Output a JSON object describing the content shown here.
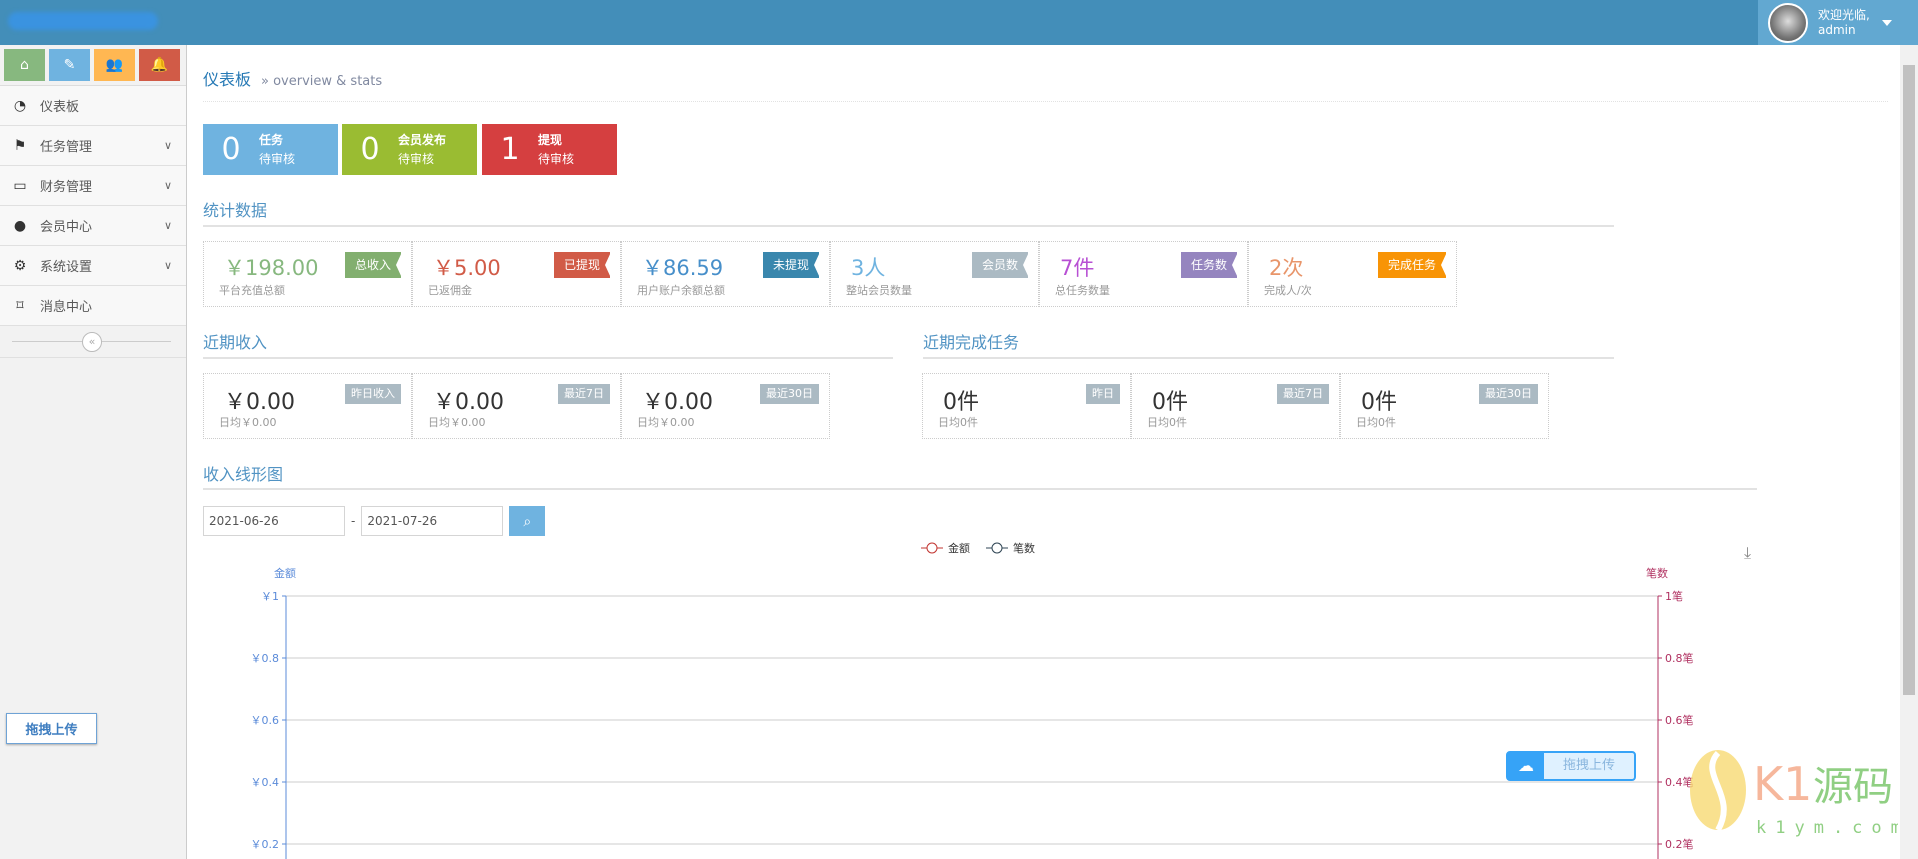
{
  "header": {
    "welcome": "欢迎光临,",
    "user": "admin"
  },
  "sidebar": {
    "shortcuts": [
      {
        "icon": "home-icon",
        "color": "#87b87f"
      },
      {
        "icon": "pencil-icon",
        "color": "#6fb3e0"
      },
      {
        "icon": "users-icon",
        "color": "#ffb752"
      },
      {
        "icon": "bell-icon",
        "color": "#d15b47"
      }
    ],
    "items": [
      {
        "label": "仪表板",
        "icon": "dashboard-icon"
      },
      {
        "label": "任务管理",
        "icon": "flag-icon"
      },
      {
        "label": "财务管理",
        "icon": "inbox-icon"
      },
      {
        "label": "会员中心",
        "icon": "user-icon"
      },
      {
        "label": "系统设置",
        "icon": "gear-icon"
      },
      {
        "label": "消息中心",
        "icon": "bookmark-icon"
      }
    ],
    "drag_upload": "拖拽上传"
  },
  "breadcrumb": {
    "title": "仪表板",
    "sub": "» overview & stats"
  },
  "infoboxes": [
    {
      "count": "0",
      "title": "任务",
      "sub": "待审核",
      "color": "#6fb3e0"
    },
    {
      "count": "0",
      "title": "会员发布",
      "sub": "待审核",
      "color": "#9abc32"
    },
    {
      "count": "1",
      "title": "提现",
      "sub": "待审核",
      "color": "#d53f40"
    }
  ],
  "stats": {
    "title": "统计数据",
    "items": [
      {
        "value": "￥198.00",
        "desc": "平台充值总额",
        "tag": "总收入",
        "color": "#87b87f",
        "tagColor": "#82af6f"
      },
      {
        "value": "￥5.00",
        "desc": "已返佣金",
        "tag": "已提现",
        "color": "#d15b47",
        "tagColor": "#d15b47"
      },
      {
        "value": "￥86.59",
        "desc": "用户账户余额总额",
        "tag": "未提现",
        "color": "#478fca",
        "tagColor": "#3a87ad"
      },
      {
        "value": "3人",
        "desc": "整站会员数量",
        "tag": "会员数",
        "color": "#6fb3e0",
        "tagColor": "#abbac3"
      },
      {
        "value": "7件",
        "desc": "总任务数量",
        "tag": "任务数",
        "color": "#b74fd3",
        "tagColor": "#9585bf"
      },
      {
        "value": "2次",
        "desc": "完成人/次",
        "tag": "完成任务",
        "color": "#e8956a",
        "tagColor": "#f89406"
      }
    ]
  },
  "recent_income": {
    "title": "近期收入",
    "items": [
      {
        "value": "￥0.00",
        "desc": "日均￥0.00",
        "tag": "昨日收入"
      },
      {
        "value": "￥0.00",
        "desc": "日均￥0.00",
        "tag": "最近7日"
      },
      {
        "value": "￥0.00",
        "desc": "日均￥0.00",
        "tag": "最近30日"
      }
    ]
  },
  "recent_tasks": {
    "title": "近期完成任务",
    "items": [
      {
        "value": "0件",
        "desc": "日均0件",
        "tag": "昨日"
      },
      {
        "value": "0件",
        "desc": "日均0件",
        "tag": "最近7日"
      },
      {
        "value": "0件",
        "desc": "日均0件",
        "tag": "最近30日"
      }
    ]
  },
  "chart_section": {
    "title": "收入线形图",
    "date_from": "2021-06-26",
    "date_to": "2021-07-26",
    "separator": "-"
  },
  "chart_data": {
    "type": "line",
    "series": [
      {
        "name": "金额",
        "color": "#c23531",
        "values": []
      },
      {
        "name": "笔数",
        "color": "#2f4554",
        "values": []
      }
    ],
    "y_left": {
      "label": "金额",
      "ticks": [
        "￥0.2",
        "￥0.4",
        "￥0.6",
        "￥0.8",
        "￥1"
      ],
      "color": "#5b8bd9"
    },
    "y_right": {
      "label": "笔数",
      "ticks": [
        "0.2笔",
        "0.4笔",
        "0.6笔",
        "0.8笔",
        "1笔"
      ],
      "color": "#b03060"
    },
    "ylim_visible": [
      0.2,
      1
    ],
    "grid": true,
    "legend": "top-center"
  },
  "floating_upload": "拖拽上传",
  "watermark": {
    "text": "K1源码",
    "url": "k1ym.com"
  }
}
